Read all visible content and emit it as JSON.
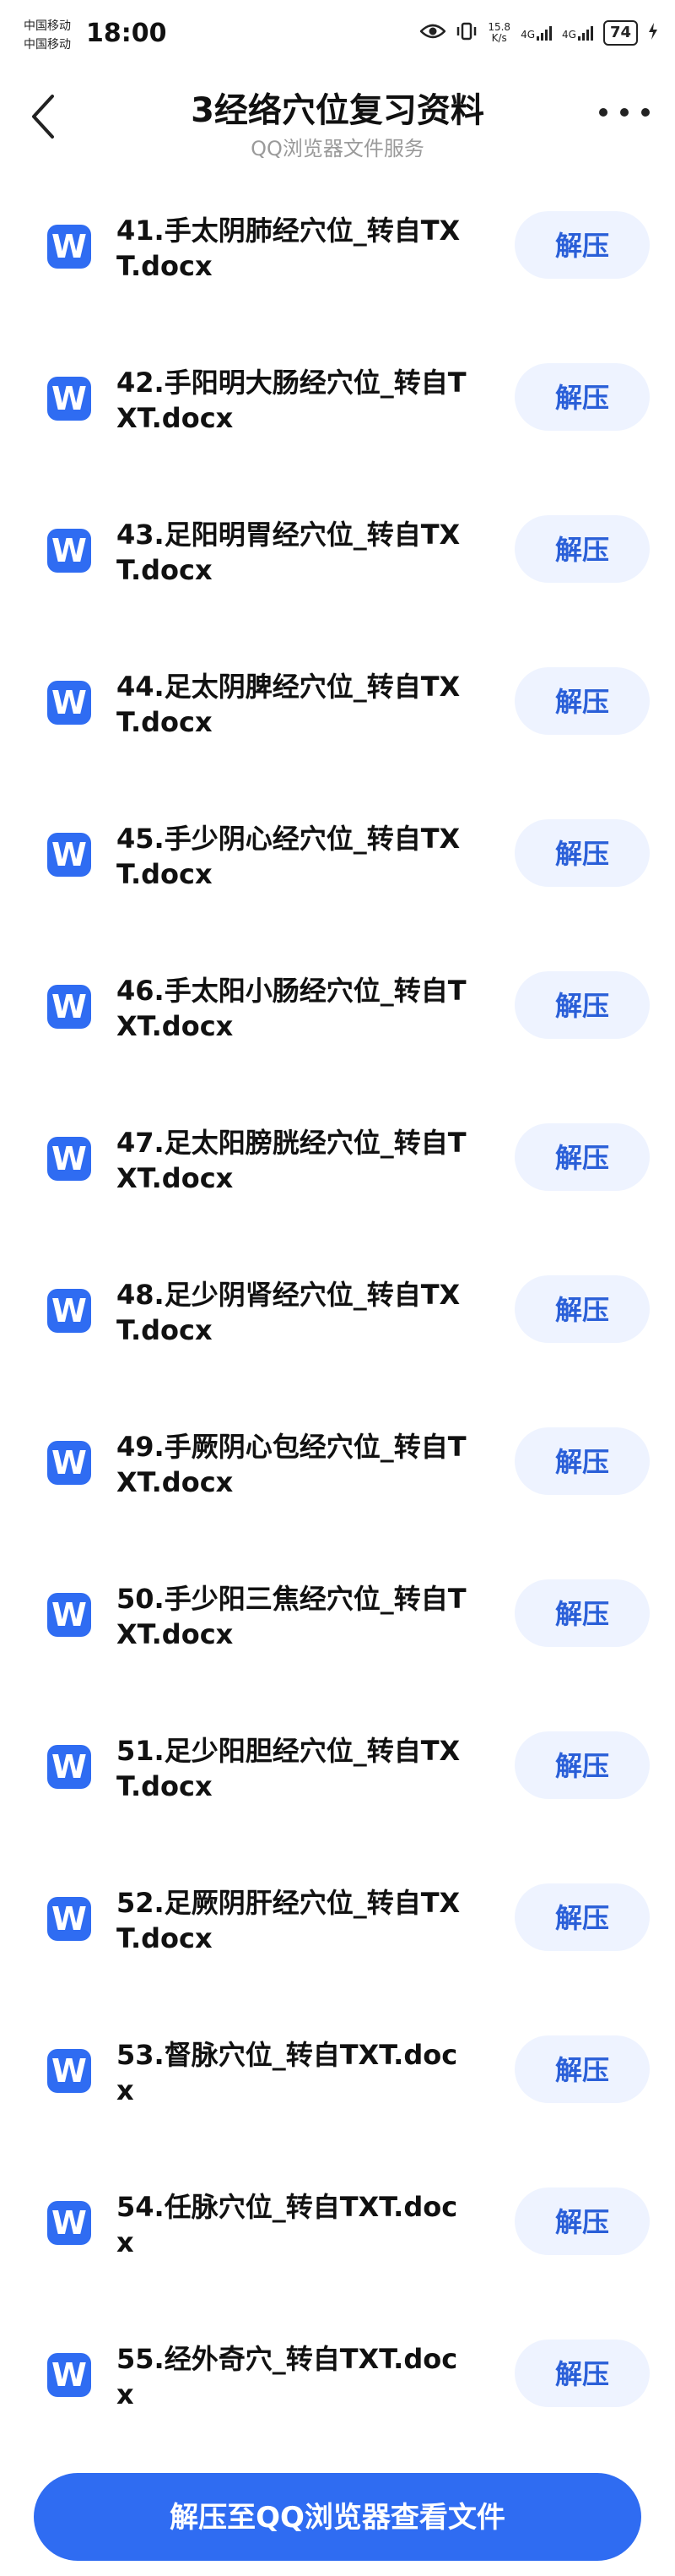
{
  "status_bar": {
    "carrier_1": "中国移动",
    "carrier_2": "中国移动",
    "time": "18:00",
    "net_speed": "15.8",
    "net_unit": "K/s",
    "net_type_1": "4G",
    "net_type_2": "4G",
    "battery": "74"
  },
  "header": {
    "title": "3经络穴位复习资料",
    "subtitle": "QQ浏览器文件服务"
  },
  "files": [
    {
      "icon": "W",
      "name": "41.手太阴肺经穴位_转自TXT.docx",
      "action": "解压"
    },
    {
      "icon": "W",
      "name": "42.手阳明大肠经穴位_转自TXT.docx",
      "action": "解压"
    },
    {
      "icon": "W",
      "name": "43.足阳明胃经穴位_转自TXT.docx",
      "action": "解压"
    },
    {
      "icon": "W",
      "name": "44.足太阴脾经穴位_转自TXT.docx",
      "action": "解压"
    },
    {
      "icon": "W",
      "name": "45.手少阴心经穴位_转自TXT.docx",
      "action": "解压"
    },
    {
      "icon": "W",
      "name": "46.手太阳小肠经穴位_转自TXT.docx",
      "action": "解压"
    },
    {
      "icon": "W",
      "name": "47.足太阳膀胱经穴位_转自TXT.docx",
      "action": "解压"
    },
    {
      "icon": "W",
      "name": "48.足少阴肾经穴位_转自TXT.docx",
      "action": "解压"
    },
    {
      "icon": "W",
      "name": "49.手厥阴心包经穴位_转自TXT.docx",
      "action": "解压"
    },
    {
      "icon": "W",
      "name": "50.手少阳三焦经穴位_转自TXT.docx",
      "action": "解压"
    },
    {
      "icon": "W",
      "name": "51.足少阳胆经穴位_转自TXT.docx",
      "action": "解压"
    },
    {
      "icon": "W",
      "name": "52.足厥阴肝经穴位_转自TXT.docx",
      "action": "解压"
    },
    {
      "icon": "W",
      "name": "53.督脉穴位_转自TXT.docx",
      "action": "解压"
    },
    {
      "icon": "W",
      "name": "54.任脉穴位_转自TXT.docx",
      "action": "解压"
    },
    {
      "icon": "W",
      "name": "55.经外奇穴_转自TXT.docx",
      "action": "解压"
    }
  ],
  "bottom_button": "解压至QQ浏览器查看文件",
  "colors": {
    "accent": "#2f6cf2",
    "button_bg": "#eef3ff",
    "button_text": "#2a5fd8",
    "subtitle": "#9a9a9a"
  }
}
